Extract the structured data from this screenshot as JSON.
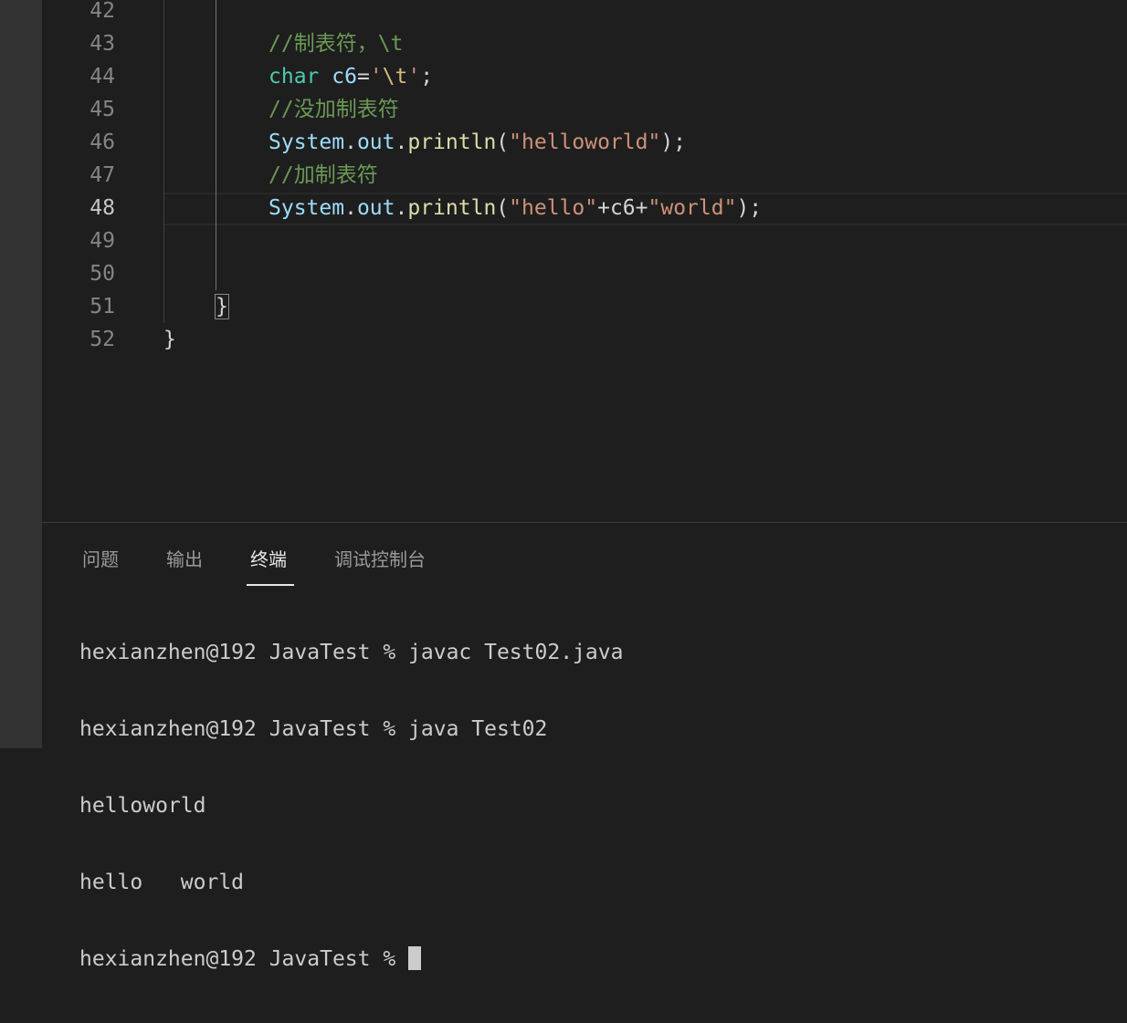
{
  "editor": {
    "line_numbers": [
      "42",
      "43",
      "44",
      "45",
      "46",
      "47",
      "48",
      "49",
      "50",
      "51",
      "52"
    ],
    "lines": {
      "l43": {
        "comment": "//制表符，\\t"
      },
      "l44": {
        "keyword": "char",
        "space": " ",
        "var": "c6",
        "eq": "=",
        "q1": "'",
        "esc": "\\t",
        "q2": "'",
        "semi": ";"
      },
      "l45": {
        "comment": "//没加制表符"
      },
      "l46": {
        "cls": "System",
        "dot1": ".",
        "field": "out",
        "dot2": ".",
        "method": "println",
        "open": "(",
        "str": "\"helloworld\"",
        "close": ");"
      },
      "l47": {
        "comment": "//加制表符"
      },
      "l48": {
        "cls": "System",
        "dot1": ".",
        "field": "out",
        "dot2": ".",
        "method": "println",
        "open": "(",
        "str1": "\"hello\"",
        "plus1": "+",
        "var": "c6",
        "plus2": "+",
        "str2": "\"world\"",
        "close": ");"
      },
      "l51": {
        "brace": "}"
      },
      "l52": {
        "brace": "}"
      }
    }
  },
  "panel": {
    "tabs": [
      {
        "label": "问题"
      },
      {
        "label": "输出"
      },
      {
        "label": "终端"
      },
      {
        "label": "调试控制台"
      }
    ],
    "active_tab": "终端",
    "terminal_lines": [
      "hexianzhen@192 JavaTest % javac Test02.java",
      "hexianzhen@192 JavaTest % java Test02",
      "helloworld",
      "hello\tworld",
      "hexianzhen@192 JavaTest % "
    ]
  },
  "colors": {
    "background": "#1e1e1e",
    "comment": "#6a9955",
    "keyword": "#4ec9b0",
    "variable": "#9cdcfe",
    "string": "#ce9178",
    "function": "#dcdcaa"
  }
}
